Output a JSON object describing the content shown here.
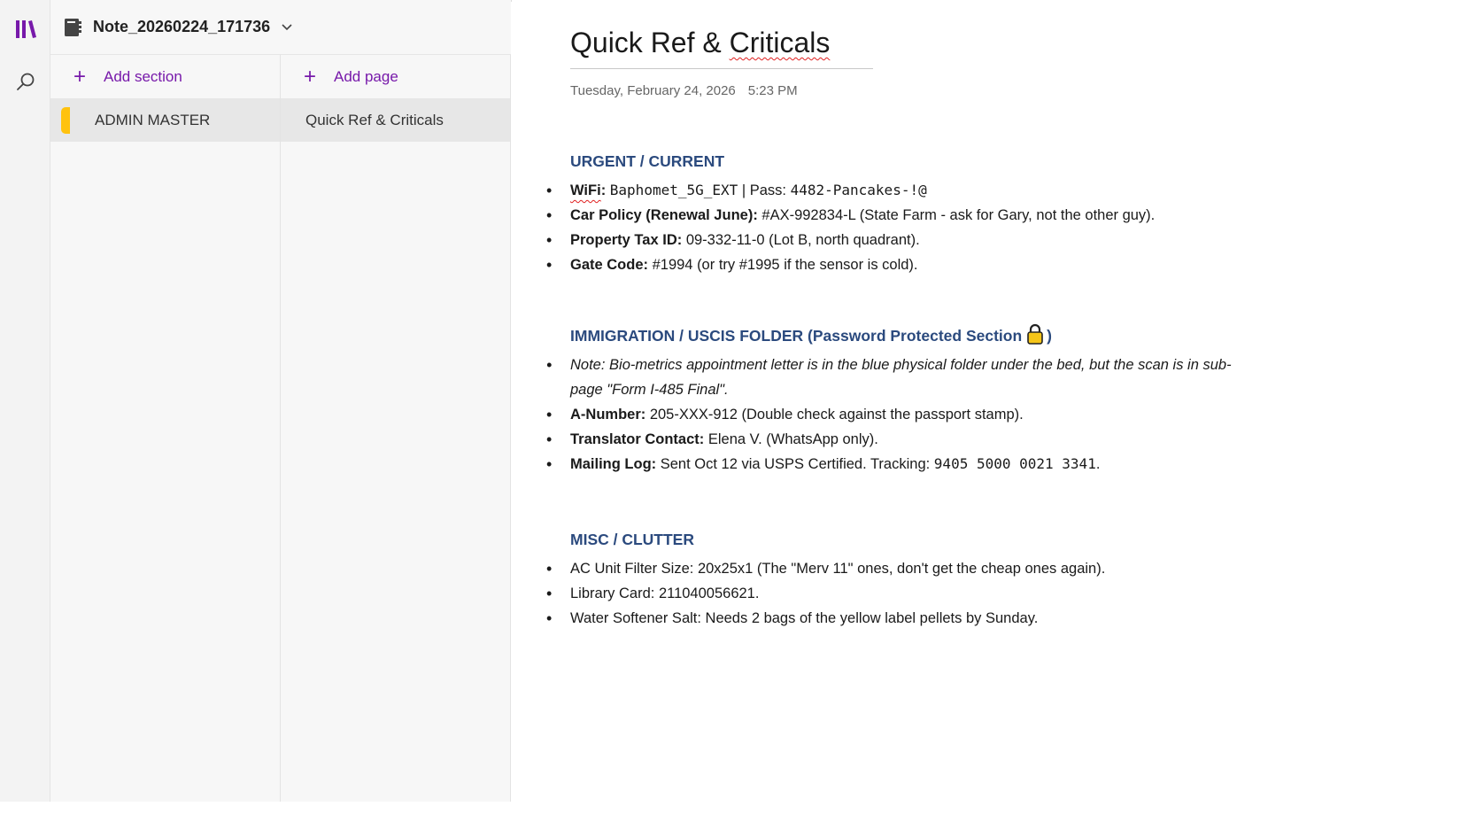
{
  "notebook": {
    "title": "Note_20260224_171736"
  },
  "sections_pane": {
    "add_label": "Add section",
    "items": [
      {
        "label": "ADMIN MASTER",
        "tab_color": "#ffc20e"
      }
    ]
  },
  "pages_pane": {
    "add_label": "Add page",
    "items": [
      {
        "label": "Quick Ref & Criticals"
      }
    ]
  },
  "page": {
    "title_part1": "Quick Ref & ",
    "title_part2": "Criticals",
    "date": "Tuesday, February 24, 2026",
    "time": "5:23 PM",
    "urgent": {
      "heading": "URGENT / CURRENT",
      "wifi": {
        "label": "WiFi",
        "colon": ":",
        "ssid": "Baphomet_5G_EXT",
        "sep": " | Pass: ",
        "pass": "4482-Pancakes-!@"
      },
      "car": {
        "label": "Car Policy (Renewal June):",
        "value": " #AX-992834-L (State Farm - ask for Gary, not the other guy)."
      },
      "tax": {
        "label": "Property Tax ID:",
        "value": " 09-332-11-0 (Lot B, north quadrant)."
      },
      "gate": {
        "label": "Gate Code:",
        "value": " #1994 (or try #1995 if the sensor is cold)."
      }
    },
    "immigration": {
      "heading_part1": "IMMIGRATION / USCIS FOLDER (",
      "heading_part2": "Password Protected Section",
      "heading_part3": ")",
      "note_line1": "Note: Bio-metrics appointment letter is in the blue physical folder under the bed, but the scan is in sub-",
      "note_line2": "page \"Form I-485 Final\".",
      "anumber": {
        "label": "A-Number:",
        "value": " 205-XXX-912 (Double check against the passport stamp)."
      },
      "translator": {
        "label": "Translator Contact:",
        "value": " Elena V. (WhatsApp only)."
      },
      "mailing": {
        "label": "Mailing Log:",
        "value": " Sent Oct 12 via USPS Certified. Tracking: ",
        "tracking": "9405 5000 0021 3341",
        "end": "."
      }
    },
    "misc": {
      "heading": "MISC / CLUTTER",
      "items": [
        "AC Unit Filter Size: 20x25x1 (The \"Merv 11\" ones, don't get the cheap ones again).",
        "Library Card: 211040056621.",
        "Water Softener Salt: Needs 2 bags of the yellow label pellets by Sunday."
      ]
    }
  },
  "icons": {
    "rail": [
      "library-icon",
      "search-icon"
    ],
    "notebook": "notebook-icon",
    "dropdown": "chevron-down-icon",
    "lock": "lock-icon"
  },
  "colors": {
    "accent": "#7719aa",
    "heading": "#2b4a7e",
    "section_tab": "#ffc20e",
    "spellcheck": "#e02020"
  }
}
